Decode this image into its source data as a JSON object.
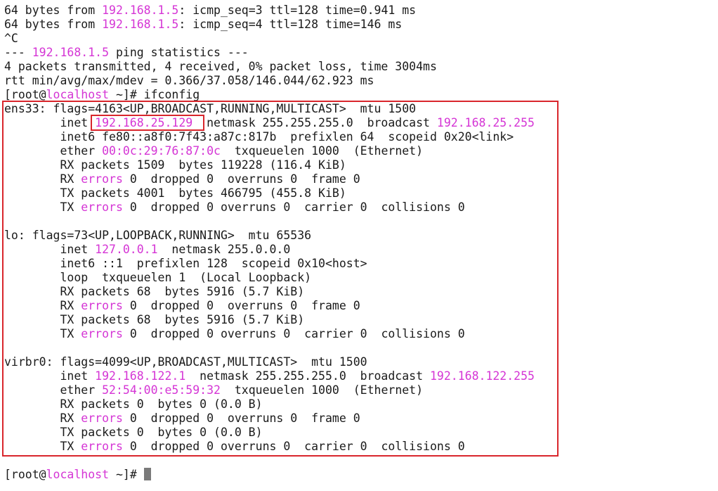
{
  "terminal": {
    "user_host": "localhost",
    "lines": [
      [
        "64 bytes from ",
        "{192.168.1.5}",
        ": icmp_seq=3 ttl=128 time=0.941 ms"
      ],
      [
        "64 bytes from ",
        "{192.168.1.5}",
        ": icmp_seq=4 ttl=128 time=146 ms"
      ],
      [
        "^C"
      ],
      [
        "--- ",
        "{192.168.1.5}",
        " ping statistics ---"
      ],
      [
        "4 packets transmitted, 4 received, 0% packet loss, time 3004ms"
      ],
      [
        "rtt min/avg/max/mdev = 0.366/37.058/146.044/62.923 ms"
      ],
      [
        "[root@",
        "{localhost}",
        " ~]# ifconfig"
      ],
      [
        "ens33: flags=4163<UP,BROADCAST,RUNNING,MULTICAST>  mtu 1500"
      ],
      [
        "        inet ",
        "{192.168.25.129}",
        "  netmask 255.255.255.0  broadcast ",
        "{192.168.25.255}"
      ],
      [
        "        inet6 fe80::a8f0:7f43:a87c:817b  prefixlen 64  scopeid 0x20<link>"
      ],
      [
        "        ether ",
        "{00:0c:29:76:87:0c}",
        "  txqueuelen 1000  (Ethernet)"
      ],
      [
        "        RX packets 1509  bytes 119228 (116.4 KiB)"
      ],
      [
        "        RX ",
        "{errors}",
        " 0  dropped 0  overruns 0  frame 0"
      ],
      [
        "        TX packets 4001  bytes 466795 (455.8 KiB)"
      ],
      [
        "        TX ",
        "{errors}",
        " 0  dropped 0 overruns 0  carrier 0  collisions 0"
      ],
      [
        ""
      ],
      [
        "lo: flags=73<UP,LOOPBACK,RUNNING>  mtu 65536"
      ],
      [
        "        inet ",
        "{127.0.0.1}",
        "  netmask 255.0.0.0"
      ],
      [
        "        inet6 ::1  prefixlen 128  scopeid 0x10<host>"
      ],
      [
        "        loop  txqueuelen 1  (Local Loopback)"
      ],
      [
        "        RX packets 68  bytes 5916 (5.7 KiB)"
      ],
      [
        "        RX ",
        "{errors}",
        " 0  dropped 0  overruns 0  frame 0"
      ],
      [
        "        TX packets 68  bytes 5916 (5.7 KiB)"
      ],
      [
        "        TX ",
        "{errors}",
        " 0  dropped 0 overruns 0  carrier 0  collisions 0"
      ],
      [
        ""
      ],
      [
        "virbr0: flags=4099<UP,BROADCAST,MULTICAST>  mtu 1500"
      ],
      [
        "        inet ",
        "{192.168.122.1}",
        "  netmask 255.255.255.0  broadcast ",
        "{192.168.122.255}"
      ],
      [
        "        ether ",
        "{52:54:00:e5:59:32}",
        "  txqueuelen 1000  (Ethernet)"
      ],
      [
        "        RX packets 0  bytes 0 (0.0 B)"
      ],
      [
        "        RX ",
        "{errors}",
        " 0  dropped 0  overruns 0  frame 0"
      ],
      [
        "        TX packets 0  bytes 0 (0.0 B)"
      ],
      [
        "        TX ",
        "{errors}",
        " 0  dropped 0 overruns 0  carrier 0  collisions 0"
      ],
      [
        ""
      ],
      [
        "[root@",
        "{localhost}",
        " ~]# "
      ]
    ]
  },
  "colors": {
    "highlight_text": "#d535d5",
    "annotation_box": "#d9262c",
    "text": "#1a1a1a",
    "background": "#ffffff"
  }
}
